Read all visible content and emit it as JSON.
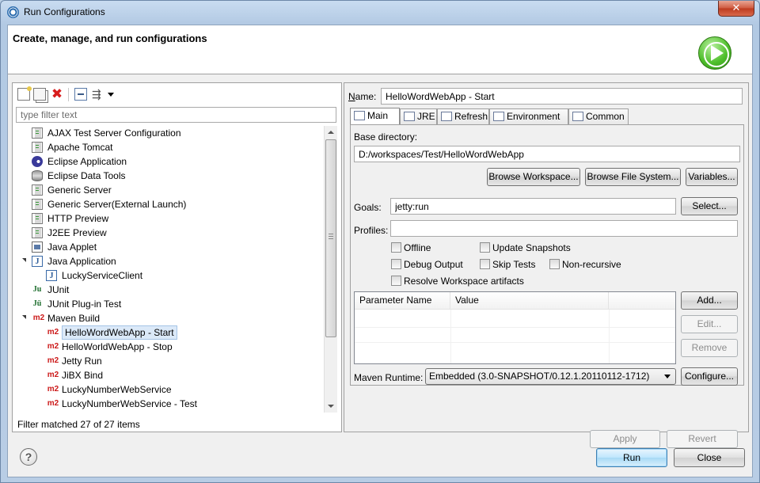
{
  "window": {
    "title": "Run Configurations",
    "close_glyph": "✕"
  },
  "header": {
    "text": "Create, manage, and run configurations"
  },
  "left": {
    "filter_placeholder": "type filter text",
    "tree": [
      {
        "label": "AJAX Test Server Configuration",
        "icon": "server-icon",
        "level": 1
      },
      {
        "label": "Apache Tomcat",
        "icon": "server-icon",
        "level": 1
      },
      {
        "label": "Eclipse Application",
        "icon": "eclipse-icon",
        "level": 1
      },
      {
        "label": "Eclipse Data Tools",
        "icon": "database-icon",
        "level": 1
      },
      {
        "label": "Generic Server",
        "icon": "server-icon",
        "level": 1
      },
      {
        "label": "Generic Server(External Launch)",
        "icon": "server-icon",
        "level": 1
      },
      {
        "label": "HTTP Preview",
        "icon": "server-icon",
        "level": 1
      },
      {
        "label": "J2EE Preview",
        "icon": "server-icon",
        "level": 1
      },
      {
        "label": "Java Applet",
        "icon": "applet-icon",
        "level": 1
      },
      {
        "label": "Java Application",
        "icon": "java-app-icon",
        "level": 1,
        "expanded": true
      },
      {
        "label": "LuckyServiceClient",
        "icon": "java-app-icon",
        "level": 2
      },
      {
        "label": "JUnit",
        "icon": "junit-icon",
        "level": 1
      },
      {
        "label": "JUnit Plug-in Test",
        "icon": "junit-plugin-icon",
        "level": 1
      },
      {
        "label": "Maven Build",
        "icon": "maven-icon",
        "level": 1,
        "expanded": true
      },
      {
        "label": "HelloWordWebApp - Start",
        "icon": "maven-icon",
        "level": 2,
        "selected": true
      },
      {
        "label": "HelloWorldWebApp - Stop",
        "icon": "maven-icon",
        "level": 2
      },
      {
        "label": "Jetty Run",
        "icon": "maven-icon",
        "level": 2
      },
      {
        "label": "JiBX Bind",
        "icon": "maven-icon",
        "level": 2
      },
      {
        "label": "LuckyNumberWebService",
        "icon": "maven-icon",
        "level": 2
      },
      {
        "label": "LuckyNumberWebService - Test",
        "icon": "maven-icon",
        "level": 2
      }
    ],
    "status": "Filter matched 27 of 27 items"
  },
  "right": {
    "name_label": "Name:",
    "name_value": "HelloWordWebApp - Start",
    "tabs": [
      {
        "label": "Main",
        "icon": "main-tab-icon",
        "active": true
      },
      {
        "label": "JRE",
        "icon": "jre-icon"
      },
      {
        "label": "Refresh",
        "icon": "refresh-icon"
      },
      {
        "label": "Environment",
        "icon": "environment-icon"
      },
      {
        "label": "Common",
        "icon": "common-icon"
      }
    ],
    "base_dir_label": "Base directory:",
    "base_dir_value": "D:/workspaces/Test/HelloWordWebApp",
    "browse_workspace": "Browse Workspace...",
    "browse_fs": "Browse File System...",
    "variables": "Variables...",
    "goals_label": "Goals:",
    "goals_value": "jetty:run",
    "select_btn": "Select...",
    "profiles_label": "Profiles:",
    "profiles_value": "",
    "checkboxes": {
      "offline": "Offline",
      "update_snapshots": "Update Snapshots",
      "debug_output": "Debug Output",
      "skip_tests": "Skip Tests",
      "non_recursive": "Non-recursive",
      "resolve_workspace": "Resolve Workspace artifacts"
    },
    "table": {
      "col_name": "Parameter Name",
      "col_value": "Value"
    },
    "add_btn": "Add...",
    "edit_btn": "Edit...",
    "remove_btn": "Remove",
    "runtime_label": "Maven Runtime:",
    "runtime_value": "Embedded (3.0-SNAPSHOT/0.12.1.20110112-1712)",
    "configure_btn": "Configure...",
    "apply_btn": "Apply",
    "revert_btn": "Revert"
  },
  "footer": {
    "help_glyph": "?",
    "run_btn": "Run",
    "close_btn": "Close"
  }
}
